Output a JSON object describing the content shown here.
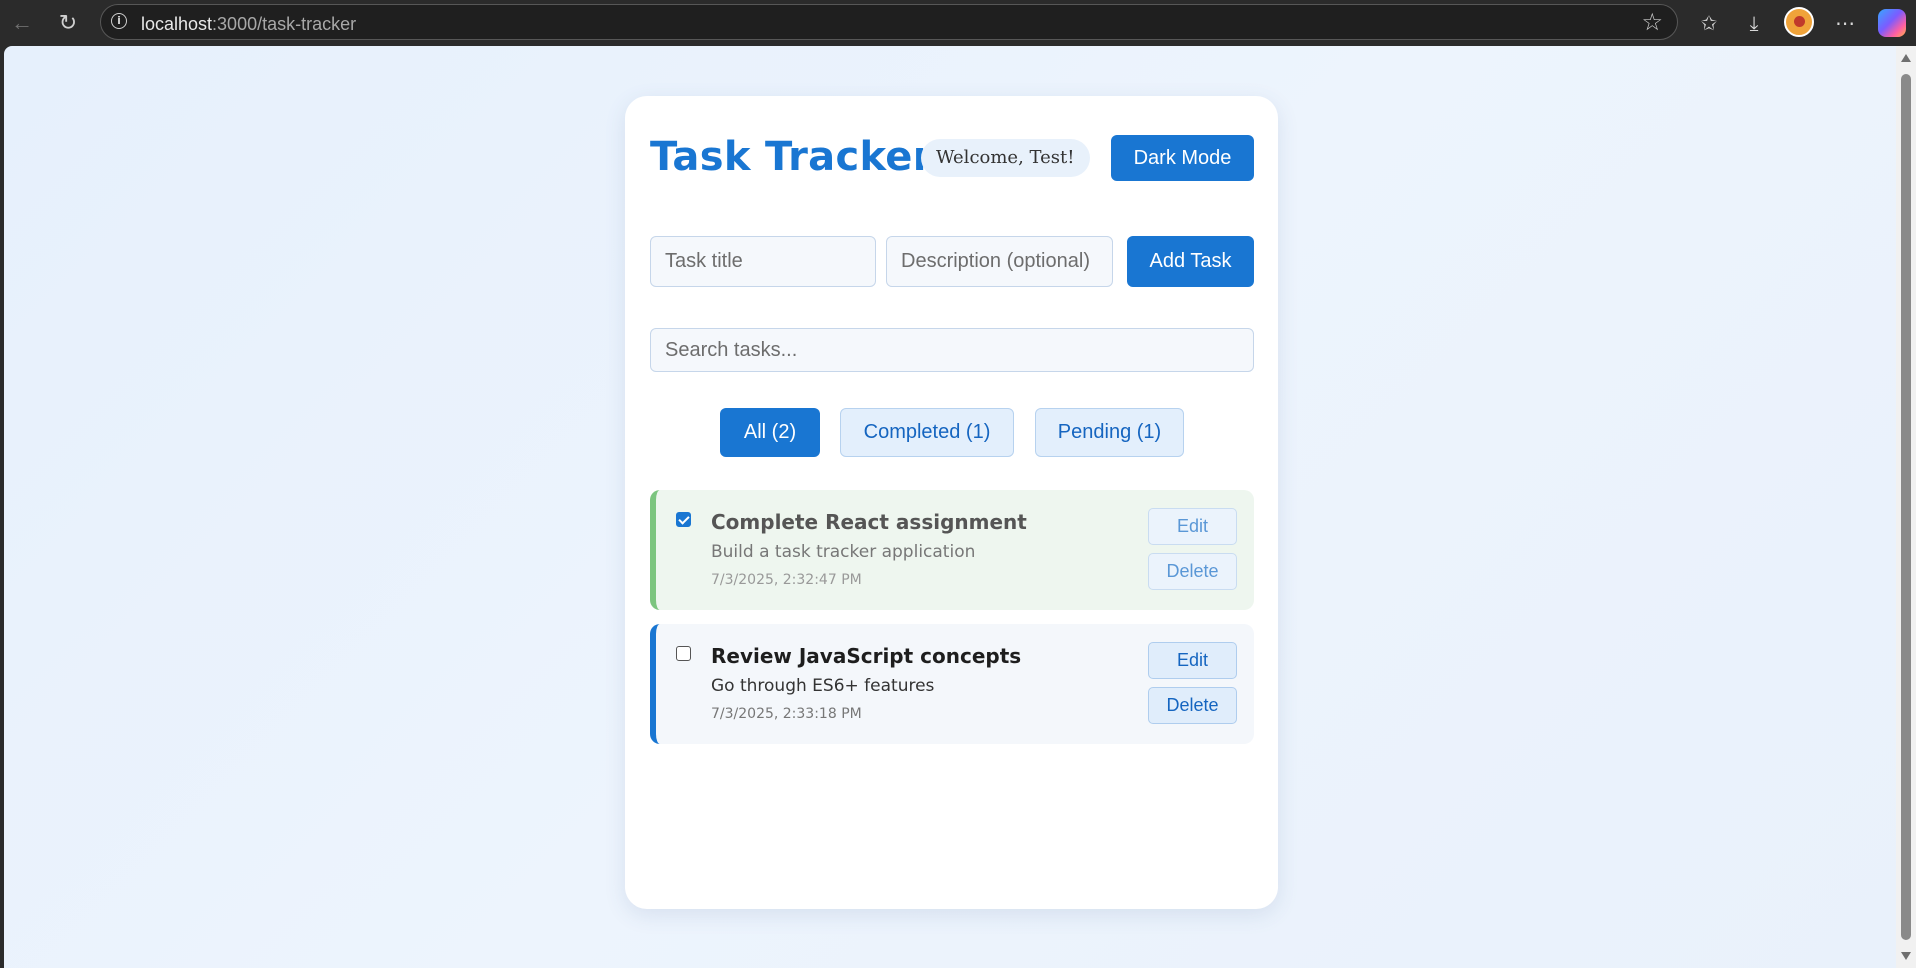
{
  "browser": {
    "url_host": "localhost",
    "url_path": ":3000/task-tracker"
  },
  "app": {
    "title": "Task Tracker",
    "welcome": "Welcome, Test!",
    "dark_mode_label": "Dark Mode",
    "accent_color": "#1976d2"
  },
  "form": {
    "title_placeholder": "Task title",
    "title_value": "",
    "description_placeholder": "Description (optional)",
    "description_value": "",
    "add_label": "Add Task"
  },
  "search": {
    "placeholder": "Search tasks...",
    "value": ""
  },
  "filters": [
    {
      "label": "All (2)",
      "active": true
    },
    {
      "label": "Completed (1)",
      "active": false
    },
    {
      "label": "Pending (1)",
      "active": false
    }
  ],
  "tasks": [
    {
      "title": "Complete React assignment",
      "description": "Build a task tracker application",
      "timestamp": "7/3/2025, 2:32:47 PM",
      "completed": true,
      "edit_label": "Edit",
      "delete_label": "Delete",
      "status_color": "#7cc57f"
    },
    {
      "title": "Review JavaScript concepts",
      "description": "Go through ES6+ features",
      "timestamp": "7/3/2025, 2:33:18 PM",
      "completed": false,
      "edit_label": "Edit",
      "delete_label": "Delete",
      "status_color": "#1976d2"
    }
  ]
}
